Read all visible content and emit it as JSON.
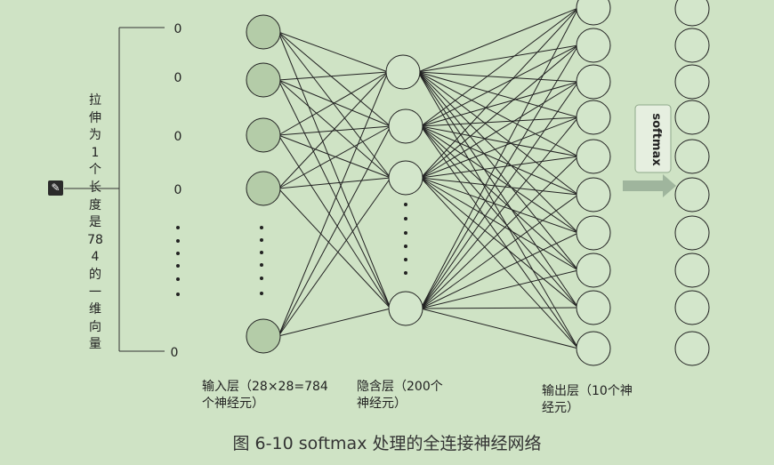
{
  "diagram": {
    "vector_values": [
      "0",
      "0",
      "0",
      "0",
      "0"
    ],
    "vector_label": "拉伸为1个长度是784的一维向量",
    "input_layer_label_1": "输入层（28×28=784",
    "input_layer_label_2": "个神经元）",
    "hidden_layer_label_1": "隐含层（200个",
    "hidden_layer_label_2": "神经元）",
    "output_layer_label_1": "输出层（10个神",
    "output_layer_label_2": "经元）",
    "softmax_label": "softmax",
    "caption": "图 6-10    softmax 处理的全连接神经网络",
    "icon": "edit-icon",
    "colors": {
      "background": "#cfe3c5",
      "input_node_fill": "#b4cca8",
      "node_fill": "#d3e6cb",
      "line": "#222222",
      "arrow": "#9fb59d"
    }
  }
}
